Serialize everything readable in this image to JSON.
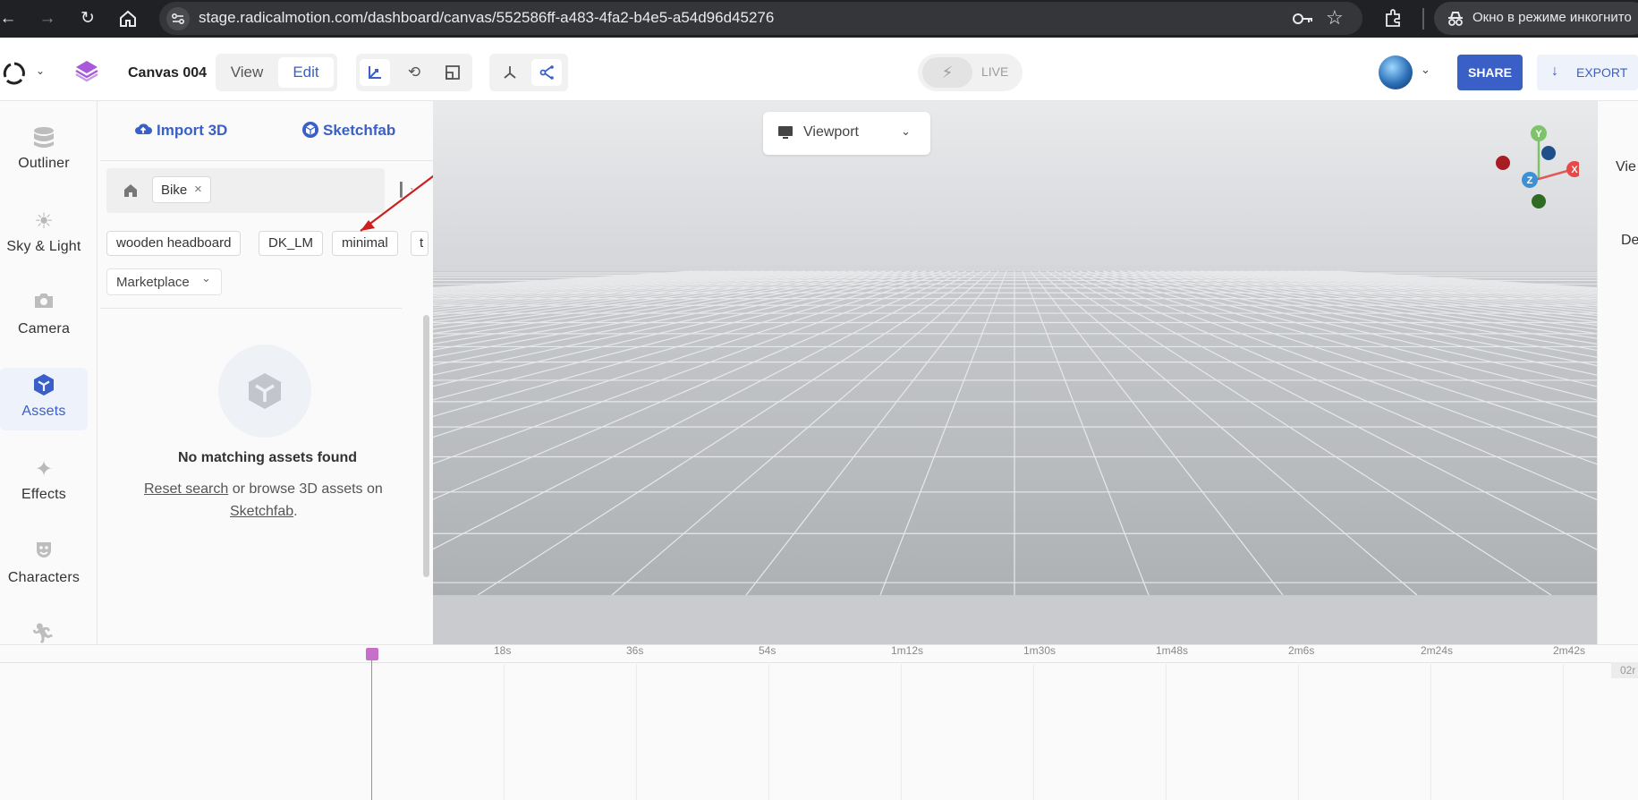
{
  "browser": {
    "url": "stage.radicalmotion.com/dashboard/canvas/552586ff-a483-4fa2-b4e5-a54d96d45276",
    "incognito_label": "Окно в режиме инкогнито"
  },
  "header": {
    "canvas_name": "Canvas 004",
    "mode_view": "View",
    "mode_edit": "Edit",
    "live_label": "LIVE",
    "share_label": "SHARE",
    "export_label": "EXPORT"
  },
  "sidebar": {
    "items": [
      {
        "label": "Outliner",
        "icon": "database-icon"
      },
      {
        "label": "Sky & Light",
        "icon": "sun-icon"
      },
      {
        "label": "Camera",
        "icon": "camera-icon"
      },
      {
        "label": "Assets",
        "icon": "assets-icon"
      },
      {
        "label": "Effects",
        "icon": "sparkle-icon"
      },
      {
        "label": "Characters",
        "icon": "mask-icon"
      }
    ]
  },
  "assets": {
    "import_label": "Import 3D",
    "sketchfab_label": "Sketchfab",
    "search_tag": "Bike",
    "chips": [
      "wooden headboard",
      "DK_LM",
      "minimal",
      "t"
    ],
    "source_filter": "Marketplace",
    "empty_title": "No matching assets found",
    "reset_link": "Reset search",
    "browse_text": "or browse 3D assets on",
    "sketchfab_link": "Sketchfab",
    "period": "."
  },
  "viewport": {
    "dropdown_label": "Viewport",
    "axes": {
      "x": "X",
      "y": "Y",
      "z": "Z"
    }
  },
  "right_panel": {
    "label_top": "Vie",
    "label_bottom": "De"
  },
  "timeline": {
    "ticks": [
      "18s",
      "36s",
      "54s",
      "1m12s",
      "1m30s",
      "1m48s",
      "2m6s",
      "2m24s",
      "2m42s"
    ],
    "end_label": "02r"
  },
  "colors": {
    "accent": "#3a5fc7",
    "playhead": "#c86fc9",
    "annotation_arrow": "#cc1f1f"
  }
}
